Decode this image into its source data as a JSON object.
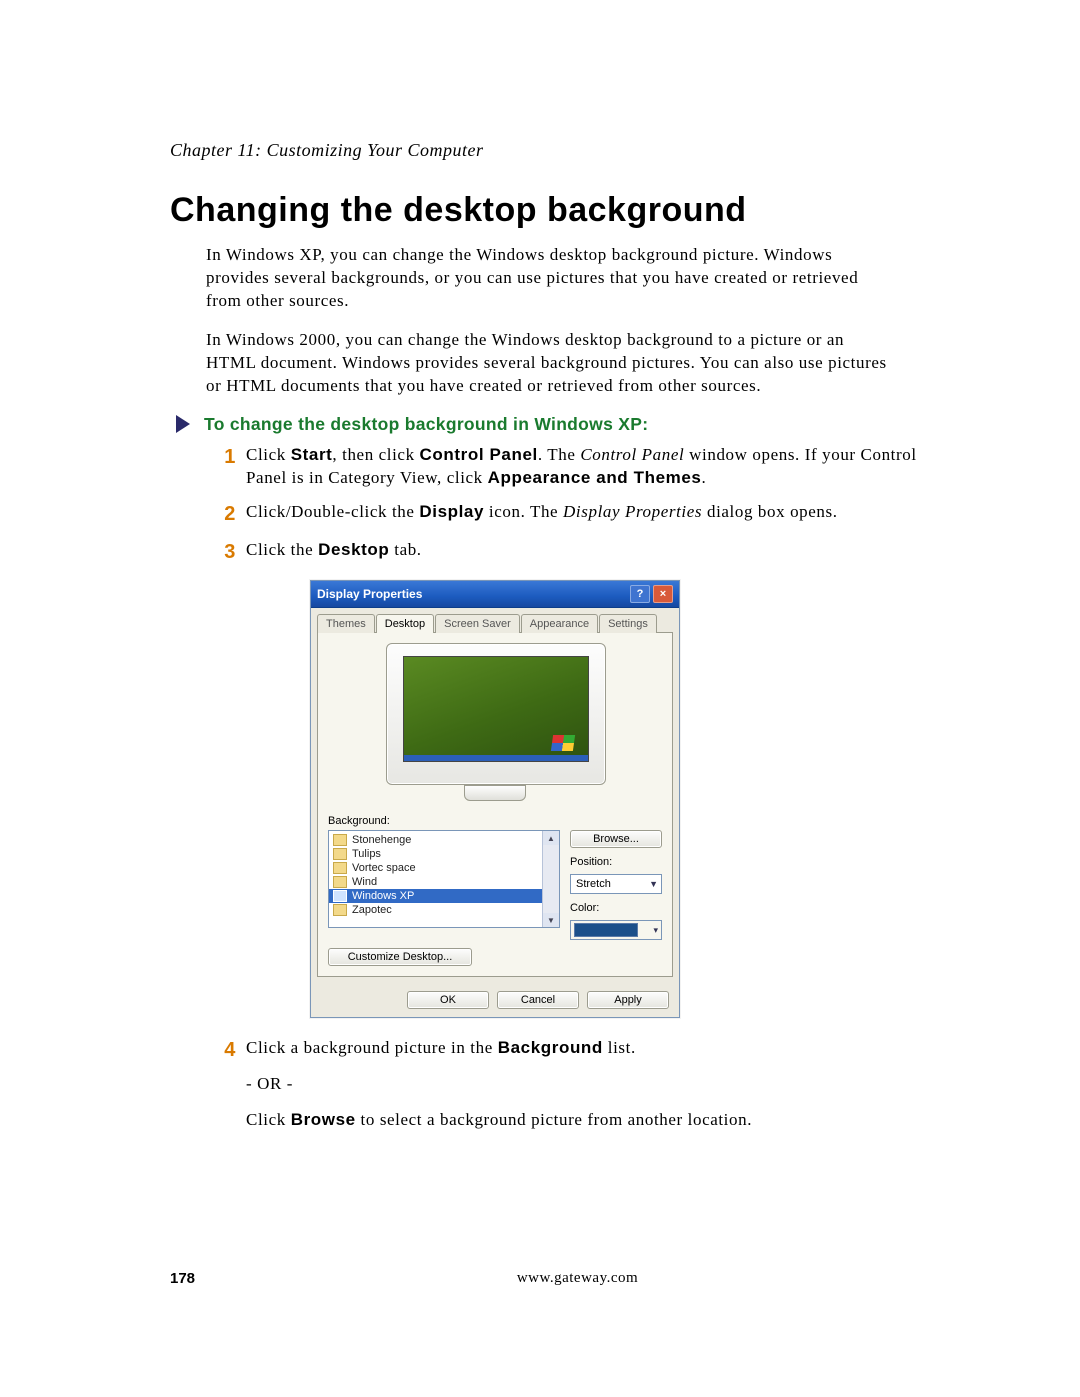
{
  "chapter": "Chapter 11: Customizing Your Computer",
  "section_title": "Changing the desktop background",
  "intro_p1": "In Windows XP, you can change the Windows desktop background picture. Windows provides several backgrounds, or you can use pictures that you have created or retrieved from other sources.",
  "intro_p2": "In Windows 2000, you can change the Windows desktop background to a picture or an HTML document. Windows provides several background pictures. You can also use pictures or HTML documents that you have created or retrieved from other sources.",
  "task_title": "To change the desktop background in Windows XP:",
  "steps": {
    "s1": {
      "num": "1",
      "pre1": "Click ",
      "b1": "Start",
      "mid1": ", then click ",
      "b2": "Control Panel",
      "mid2": ". The ",
      "i1": "Control Panel",
      "mid3": " window opens. If your Control Panel is in Category View, click ",
      "b3": "Appearance and Themes",
      "end": "."
    },
    "s2": {
      "num": "2",
      "pre1": "Click/Double-click the ",
      "b1": "Display",
      "mid1": " icon. The ",
      "i1": "Display Properties",
      "end": " dialog box opens."
    },
    "s3": {
      "num": "3",
      "pre1": "Click the ",
      "b1": "Desktop",
      "end": " tab."
    },
    "s4": {
      "num": "4",
      "pre1": "Click a background picture in the ",
      "b1": "Background",
      "mid1": " list.",
      "or": "- OR -",
      "pre2": "Click ",
      "b2": "Browse",
      "end2": " to select a background picture from another location."
    }
  },
  "dialog": {
    "title": "Display Properties",
    "help": "?",
    "close": "×",
    "tabs": [
      "Themes",
      "Desktop",
      "Screen Saver",
      "Appearance",
      "Settings"
    ],
    "active_tab": "Desktop",
    "background_label": "Background:",
    "bg_items": [
      "Stonehenge",
      "Tulips",
      "Vortec space",
      "Wind",
      "Windows XP",
      "Zapotec"
    ],
    "bg_selected": "Windows XP",
    "browse": "Browse...",
    "position_label": "Position:",
    "position_value": "Stretch",
    "color_label": "Color:",
    "customize": "Customize Desktop...",
    "ok": "OK",
    "cancel": "Cancel",
    "apply": "Apply"
  },
  "footer": {
    "page_num": "178",
    "url": "www.gateway.com"
  }
}
